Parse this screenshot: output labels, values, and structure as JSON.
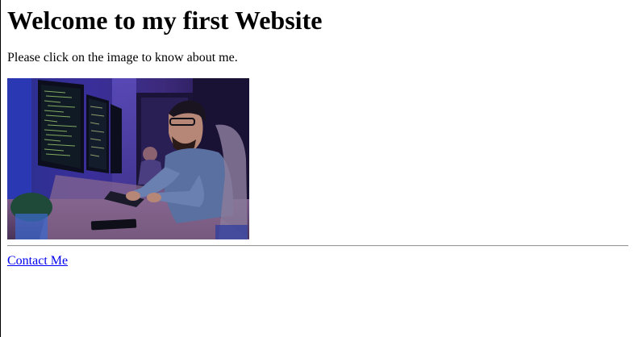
{
  "page": {
    "heading": "Welcome to my first Website",
    "intro": "Please click on the image to know about me.",
    "contact_link": "Contact Me"
  },
  "image": {
    "subject": "developer at desk with multiple monitors showing code",
    "icon": "photo-icon"
  },
  "colors": {
    "link": "#0000ee",
    "text": "#000000",
    "rule": "#9a9a9a",
    "background": "#ffffff"
  }
}
